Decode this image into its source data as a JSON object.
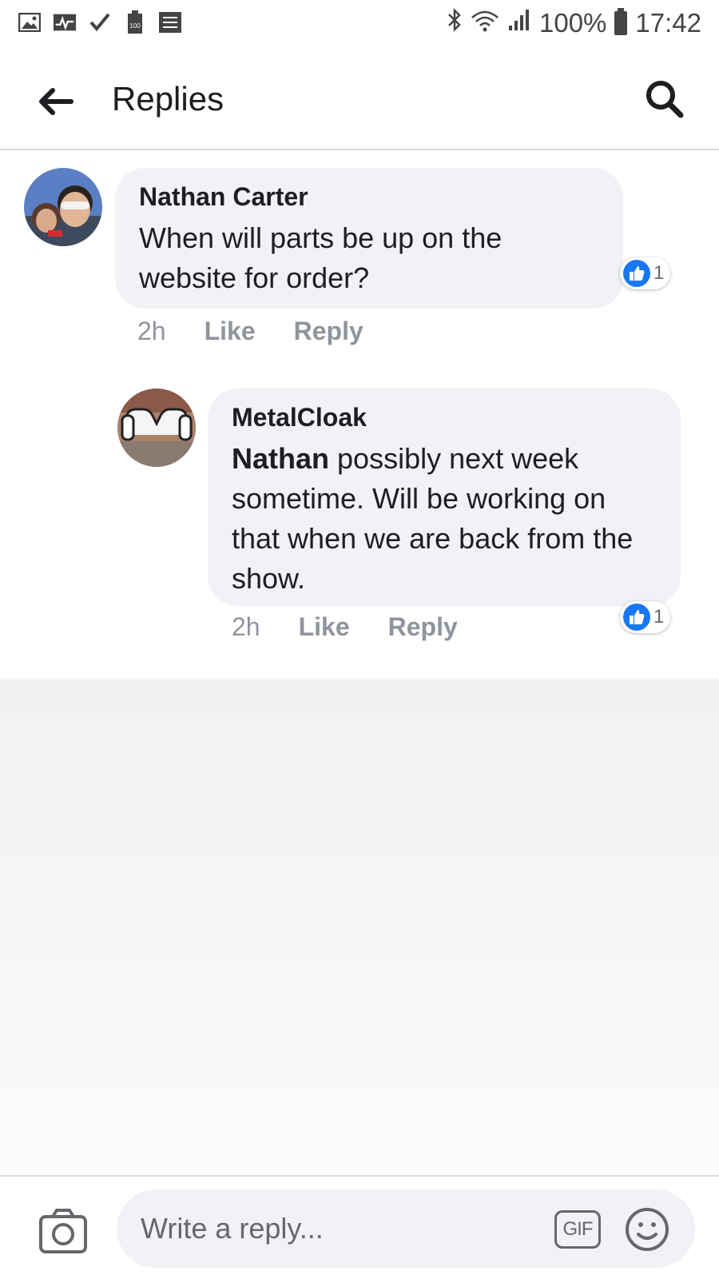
{
  "status_bar": {
    "battery_percent": "100%",
    "time": "17:42"
  },
  "header": {
    "title": "Replies"
  },
  "comments": [
    {
      "author": "Nathan Carter",
      "text": "When will parts be up on the website for order?",
      "time": "2h",
      "like_label": "Like",
      "reply_label": "Reply",
      "reaction_count": "1"
    },
    {
      "author": "MetalCloak",
      "mention": "Nathan",
      "text": "possibly next week sometime. Will be working on that when we are back from the show.",
      "time": "2h",
      "like_label": "Like",
      "reply_label": "Reply",
      "reaction_count": "1"
    }
  ],
  "composer": {
    "placeholder": "Write a reply...",
    "gif_label": "GIF"
  },
  "colors": {
    "like_blue": "#1877f2",
    "bubble_bg": "#f0f2f5",
    "meta_gray": "#90949c"
  }
}
